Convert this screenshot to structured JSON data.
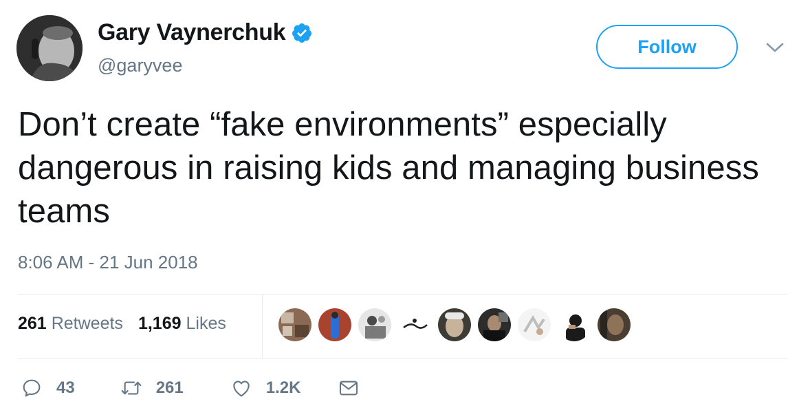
{
  "author": {
    "name": "Gary Vaynerchuk",
    "handle": "@garyvee",
    "verified": true
  },
  "follow_button": {
    "label": "Follow"
  },
  "tweet": {
    "text": "Don’t create “fake environments” especially dangerous in raising kids and managing business  teams",
    "timestamp": "8:06 AM - 21 Jun 2018"
  },
  "stats": {
    "retweets_count": "261",
    "retweets_label": "Retweets",
    "likes_count": "1,169",
    "likes_label": "Likes"
  },
  "likers": [
    {
      "id": "liker-1",
      "color": "#8a6a55"
    },
    {
      "id": "liker-2",
      "color": "#2a6fd6"
    },
    {
      "id": "liker-3",
      "color": "#9a9a9a"
    },
    {
      "id": "liker-4",
      "color": "#222222"
    },
    {
      "id": "liker-5",
      "color": "#6b5a4a"
    },
    {
      "id": "liker-6",
      "color": "#2c2c2c"
    },
    {
      "id": "liker-7",
      "color": "#bdbdbd"
    },
    {
      "id": "liker-8",
      "color": "#1a1a1a"
    },
    {
      "id": "liker-9",
      "color": "#4a3e33"
    }
  ],
  "actions": {
    "replies": "43",
    "retweets": "261",
    "likes": "1.2K"
  },
  "colors": {
    "accent": "#1da1f2",
    "text": "#14171a",
    "muted": "#657786",
    "divider": "#e6ecf0"
  }
}
